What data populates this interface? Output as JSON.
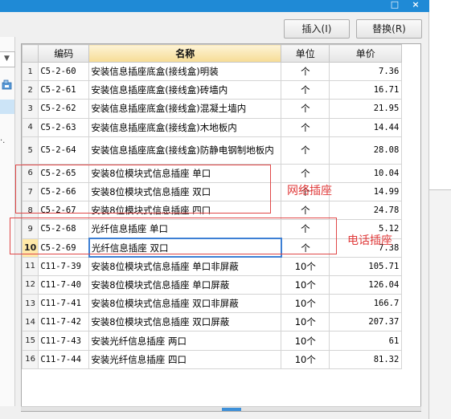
{
  "window": {
    "maximize_glyph": "□",
    "close_glyph": "×"
  },
  "toolbar": {
    "insert_label": "插入(I)",
    "replace_label": "替换(R)"
  },
  "grid": {
    "columns": [
      "编码",
      "名称",
      "单位",
      "单价"
    ],
    "rows": [
      {
        "no": "1",
        "code": "C5-2-60",
        "name": "安装信息插座底盒(接线盒)明装",
        "unit": "个",
        "price": "7.36"
      },
      {
        "no": "2",
        "code": "C5-2-61",
        "name": "安装信息插座底盒(接线盒)砖墙内",
        "unit": "个",
        "price": "16.71"
      },
      {
        "no": "3",
        "code": "C5-2-62",
        "name": "安装信息插座底盒(接线盒)混凝土墙内",
        "unit": "个",
        "price": "21.95"
      },
      {
        "no": "4",
        "code": "C5-2-63",
        "name": "安装信息插座底盒(接线盒)木地板内",
        "unit": "个",
        "price": "14.44"
      },
      {
        "no": "5",
        "code": "C5-2-64",
        "name": "安装信息插座底盒(接线盒)防静电钢制地板内",
        "unit": "个",
        "price": "28.08"
      },
      {
        "no": "6",
        "code": "C5-2-65",
        "name": "安装8位模块式信息插座 单口",
        "unit": "个",
        "price": "10.04"
      },
      {
        "no": "7",
        "code": "C5-2-66",
        "name": "安装8位模块式信息插座 双口",
        "unit": "个",
        "price": "14.99"
      },
      {
        "no": "8",
        "code": "C5-2-67",
        "name": "安装8位模块式信息插座 四口",
        "unit": "个",
        "price": "24.78"
      },
      {
        "no": "9",
        "code": "C5-2-68",
        "name": "光纤信息插座 单口",
        "unit": "个",
        "price": "5.12"
      },
      {
        "no": "10",
        "code": "C5-2-69",
        "name": "光纤信息插座 双口",
        "unit": "个",
        "price": "7.38"
      },
      {
        "no": "11",
        "code": "C11-7-39",
        "name": "安装8位模块式信息插座 单口非屏蔽",
        "unit": "10个",
        "price": "105.71"
      },
      {
        "no": "12",
        "code": "C11-7-40",
        "name": "安装8位模块式信息插座 单口屏蔽",
        "unit": "10个",
        "price": "126.04"
      },
      {
        "no": "13",
        "code": "C11-7-41",
        "name": "安装8位模块式信息插座 双口非屏蔽",
        "unit": "10个",
        "price": "166.7"
      },
      {
        "no": "14",
        "code": "C11-7-42",
        "name": "安装8位模块式信息插座 双口屏蔽",
        "unit": "10个",
        "price": "207.37"
      },
      {
        "no": "15",
        "code": "C11-7-43",
        "name": "安装光纤信息插座 两口",
        "unit": "10个",
        "price": "61"
      },
      {
        "no": "16",
        "code": "C11-7-44",
        "name": "安装光纤信息插座 四口",
        "unit": "10个",
        "price": "81.32"
      }
    ]
  },
  "annotations": {
    "network_socket": "网络插座",
    "phone_socket": "电话插座"
  },
  "colors": {
    "annotation": "#e03a3a",
    "selection": "#3d7fd4",
    "active_row_header": "#ffe9a8",
    "sorted_header": "#f6dc95"
  }
}
